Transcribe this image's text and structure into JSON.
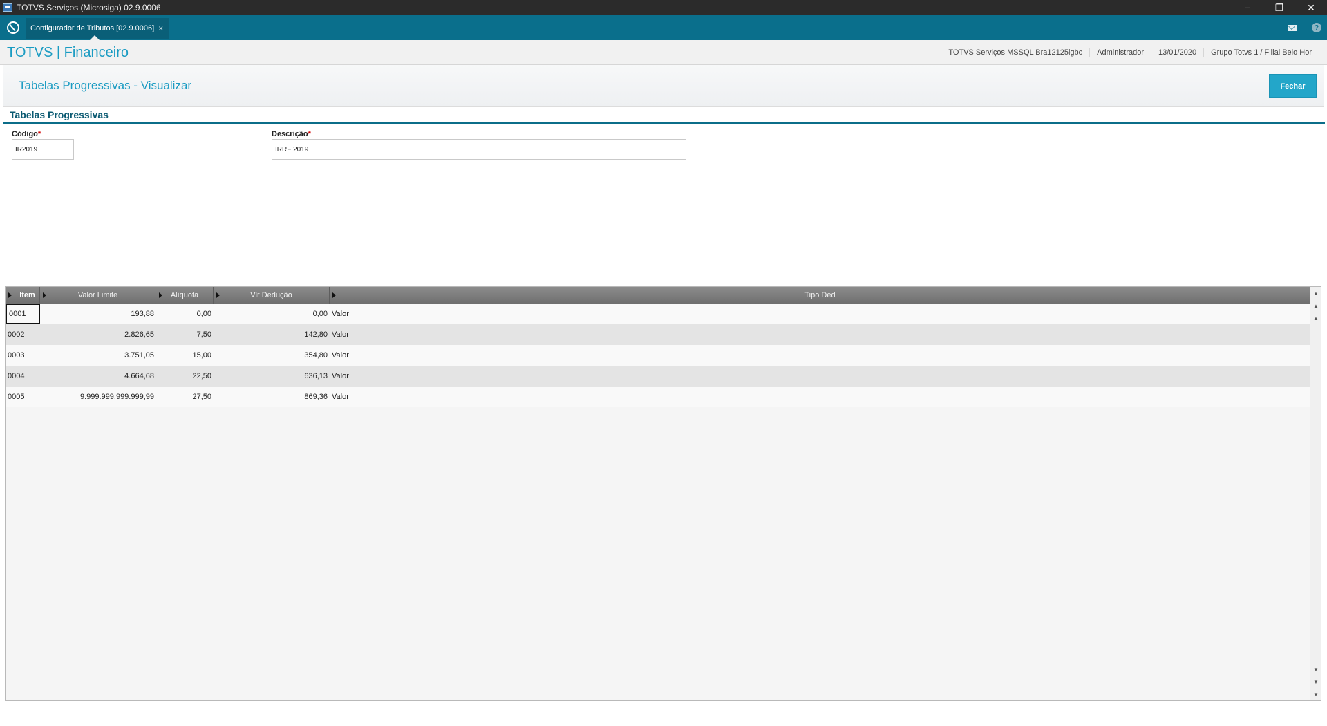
{
  "window": {
    "title": "TOTVS Serviços (Microsiga) 02.9.0006",
    "minimize": "−",
    "restore": "❐",
    "close": "✕"
  },
  "tabs": {
    "active_label": "Configurador de Tributos [02.9.0006]",
    "close_glyph": "×",
    "help_glyph": "?"
  },
  "header": {
    "brand": "TOTVS | Financeiro",
    "environment": "TOTVS Serviços MSSQL Bra12125lgbc",
    "user": "Administrador",
    "date": "13/01/2020",
    "branch": "Grupo Totvs 1 / Filial Belo Hor"
  },
  "page": {
    "title": "Tabelas Progressivas - Visualizar",
    "close_button": "Fechar"
  },
  "section": {
    "title": "Tabelas Progressivas"
  },
  "form": {
    "codigo_label": "Código",
    "codigo_value": "IR2019",
    "descricao_label": "Descrição",
    "descricao_value": "IRRF 2019",
    "required_mark": "*"
  },
  "grid": {
    "columns": [
      "Item",
      "Valor Limite",
      "Alíquota",
      "Vlr Dedução",
      "Tipo Ded"
    ],
    "rows": [
      {
        "item": "0001",
        "valor_limite": "193,88",
        "aliquota": "0,00",
        "vlr_deducao": "0,00",
        "tipo_ded": "Valor"
      },
      {
        "item": "0002",
        "valor_limite": "2.826,65",
        "aliquota": "7,50",
        "vlr_deducao": "142,80",
        "tipo_ded": "Valor"
      },
      {
        "item": "0003",
        "valor_limite": "3.751,05",
        "aliquota": "15,00",
        "vlr_deducao": "354,80",
        "tipo_ded": "Valor"
      },
      {
        "item": "0004",
        "valor_limite": "4.664,68",
        "aliquota": "22,50",
        "vlr_deducao": "636,13",
        "tipo_ded": "Valor"
      },
      {
        "item": "0005",
        "valor_limite": "9.999.999.999.999,99",
        "aliquota": "27,50",
        "vlr_deducao": "869,36",
        "tipo_ded": "Valor"
      }
    ],
    "selected_row": 0
  },
  "colors": {
    "accent": "#1a9bc2",
    "tabbar": "#0a6f8c",
    "titlebar": "#2b2b2b",
    "close_button": "#23a6c9"
  }
}
